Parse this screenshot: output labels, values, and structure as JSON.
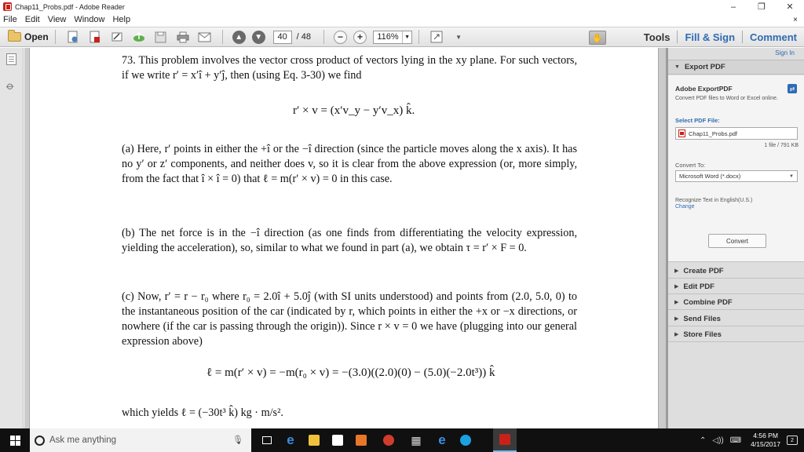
{
  "window": {
    "title": "Chap11_Probs.pdf - Adobe Reader",
    "minimize": "–",
    "restore": "❐",
    "close": "✕"
  },
  "menu": {
    "items": [
      "File",
      "Edit",
      "View",
      "Window",
      "Help"
    ],
    "close_doc": "×"
  },
  "toolbar": {
    "open_label": "Open",
    "current_page": "40",
    "total_pages": "/ 48",
    "zoom": "116%",
    "zoom_out": "−",
    "zoom_in": "+",
    "tools_label": "Tools",
    "fill_sign_label": "Fill & Sign",
    "comment_label": "Comment"
  },
  "document": {
    "p73": "73. This problem involves the vector cross product of vectors lying in the xy plane. For such vectors, if we write r′ = x′î + y′ĵ, then (using Eq. 3-30) we find",
    "eq1": "r′ × v = (x′v_y − y′v_x) k̂.",
    "pa": "(a) Here, r′ points in either the +î or the −î direction (since the particle moves along the x axis). It has no y′ or z′ components, and neither does v, so it is clear from the above expression (or, more simply, from the fact that î × î = 0) that ℓ = m(r′ × v) = 0 in this case.",
    "pb": "(b) The net force is in the −î direction (as one finds from differentiating the velocity expression, yielding the acceleration), so, similar to what we found in part (a), we obtain τ = r′ × F = 0.",
    "pc": "(c) Now, r′ = r − r₀ where r₀ = 2.0î + 5.0ĵ (with SI units understood) and points from (2.0, 5.0, 0) to the instantaneous position of the car (indicated by r, which points in either the +x or −x directions, or nowhere (if the car is passing through the origin)). Since r × v = 0 we have (plugging into our general expression above)",
    "eq2": "ℓ = m(r′ × v) = −m(r₀ × v) = −(3.0)((2.0)(0) − (5.0)(−2.0t³)) k̂",
    "final": "which yields ℓ = (−30t³ k̂) kg · m/s²."
  },
  "panel": {
    "signin": "Sign In",
    "export_header": "Export PDF",
    "export_title": "Adobe ExportPDF",
    "export_desc": "Convert PDF files to Word or Excel online.",
    "select_label": "Select PDF File:",
    "file_name": "Chap11_Probs.pdf",
    "file_count": "1 file / 791 KB",
    "convert_to_label": "Convert To:",
    "format": "Microsoft Word (*.docx)",
    "recognize": "Recognize Text in English(U.S.)",
    "change": "Change",
    "convert_button": "Convert",
    "sections": [
      "Create PDF",
      "Edit PDF",
      "Combine PDF",
      "Send Files",
      "Store Files"
    ]
  },
  "taskbar": {
    "search_placeholder": "Ask me anything",
    "time": "4:56 PM",
    "date": "4/15/2017",
    "notifications": "2"
  }
}
